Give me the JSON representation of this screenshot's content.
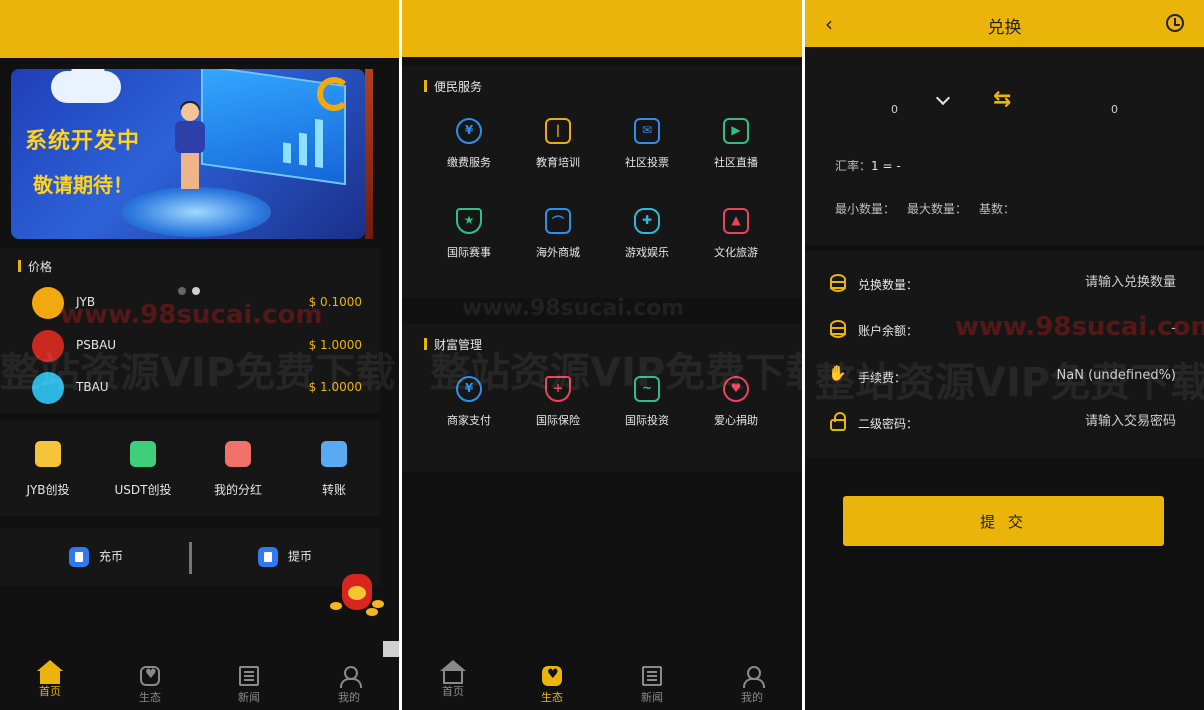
{
  "watermark": {
    "domain": "www.98sucai.com",
    "slogan": "整站资源VIP免费下载"
  },
  "home": {
    "banner": {
      "title": "系统开发中",
      "subtitle": "敬请期待！"
    },
    "price_section": {
      "title": "价格",
      "coins": [
        {
          "name": "JYB",
          "price": "$ 0.1000",
          "color": "#f2a90f"
        },
        {
          "name": "PSBAU",
          "price": "$ 1.0000",
          "color": "#c9281e"
        },
        {
          "name": "TBAU",
          "price": "$ 1.0000",
          "color": "#2ab6e0"
        }
      ]
    },
    "actions": [
      {
        "label": "JYB创投",
        "color": "#f5c43a"
      },
      {
        "label": "USDT创投",
        "color": "#3fcf7a"
      },
      {
        "label": "我的分红",
        "color": "#f0706a"
      },
      {
        "label": "转账",
        "color": "#5aaaf2"
      }
    ],
    "recharge_label": "充币",
    "withdraw_label": "提币"
  },
  "ecology": {
    "services_title": "便民服务",
    "services": [
      {
        "label": "缴费服务",
        "icon": "payment-icon",
        "color": "#2f8fe8"
      },
      {
        "label": "教育培训",
        "icon": "book-icon",
        "color": "#f2a90f"
      },
      {
        "label": "社区投票",
        "icon": "vote-icon",
        "color": "#2f8fe8"
      },
      {
        "label": "社区直播",
        "icon": "live-icon",
        "color": "#2fbf8a"
      },
      {
        "label": "国际赛事",
        "icon": "trophy-icon",
        "color": "#2fbf8a"
      },
      {
        "label": "海外商城",
        "icon": "shop-bag-icon",
        "color": "#2f8fe8"
      },
      {
        "label": "游戏娱乐",
        "icon": "gamepad-icon",
        "color": "#2fb8d8"
      },
      {
        "label": "文化旅游",
        "icon": "travel-icon",
        "color": "#e8455a"
      }
    ],
    "finance_title": "财富管理",
    "finance": [
      {
        "label": "商家支付",
        "icon": "merchant-pay-icon",
        "color": "#2f8fe8"
      },
      {
        "label": "国际保险",
        "icon": "shield-icon",
        "color": "#e8455a"
      },
      {
        "label": "国际投资",
        "icon": "investment-chart-icon",
        "color": "#2fbf8a"
      },
      {
        "label": "爱心捐助",
        "icon": "heart-icon",
        "color": "#e8455a"
      }
    ]
  },
  "tabs": [
    {
      "label": "首页"
    },
    {
      "label": "生态"
    },
    {
      "label": "新闻"
    },
    {
      "label": "我的"
    }
  ],
  "exchange": {
    "title": "兑换",
    "from_value": "0",
    "to_value": "0",
    "rate_label": "汇率：",
    "rate_value": "1 = -",
    "min_label": "最小数量：",
    "max_label": "最大数量：",
    "base_label": "基数：",
    "form": {
      "amount_label": "兑换数量：",
      "amount_placeholder": "请输入兑换数量",
      "balance_label": "账户余额：",
      "balance_value": "-",
      "fee_label": "手续费：",
      "fee_value": "NaN (undefined%)",
      "password_label": "二级密码：",
      "password_placeholder": "请输入交易密码"
    },
    "submit_label": "提 交"
  },
  "colors": {
    "accent": "#eab40b",
    "background": "#111111",
    "card": "#161616"
  }
}
